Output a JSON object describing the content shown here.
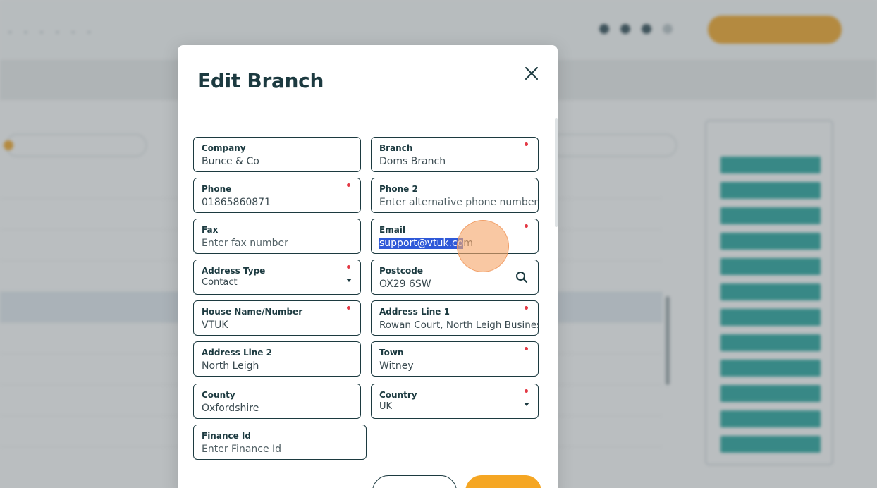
{
  "modal": {
    "title": "Edit Branch",
    "fields": {
      "company": {
        "label": "Company",
        "value": "Bunce & Co"
      },
      "branch": {
        "label": "Branch",
        "value": "Doms Branch"
      },
      "phone": {
        "label": "Phone",
        "value": "01865860871"
      },
      "phone2": {
        "label": "Phone 2",
        "placeholder": "Enter alternative phone number"
      },
      "fax": {
        "label": "Fax",
        "placeholder": "Enter fax number"
      },
      "email": {
        "label": "Email",
        "value_highlight": "support@vtuk.co",
        "value_rest": "m"
      },
      "address_type": {
        "label": "Address Type",
        "value": "Contact"
      },
      "postcode": {
        "label": "Postcode",
        "value": "OX29 6SW"
      },
      "house": {
        "label": "House Name/Number",
        "value": "VTUK"
      },
      "address1": {
        "label": "Address Line 1",
        "value": "Rowan Court, North Leigh Business"
      },
      "address2": {
        "label": "Address Line 2",
        "value": "North Leigh"
      },
      "town": {
        "label": "Town",
        "value": "Witney"
      },
      "county": {
        "label": "County",
        "value": "Oxfordshire"
      },
      "country": {
        "label": "Country",
        "value": "UK"
      },
      "finance": {
        "label": "Finance Id",
        "placeholder": "Enter Finance Id"
      }
    }
  },
  "icons": [
    "close-icon",
    "search-icon",
    "dropdown-caret-icon",
    "required-dot-icon"
  ],
  "colors": {
    "primary": "#1c3a40",
    "accent": "#f5a623",
    "required": "#e33945",
    "selection": "#2f59d8",
    "teal": "#1fa39b"
  }
}
